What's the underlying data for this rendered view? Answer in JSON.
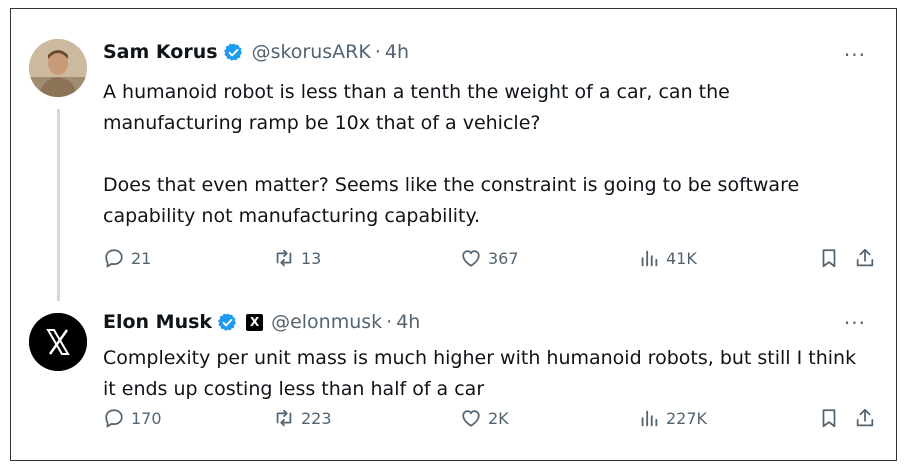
{
  "tweets": [
    {
      "author_name": "Sam Korus",
      "handle": "@skorusARK",
      "separator": "·",
      "time": "4h",
      "more": "···",
      "paragraphs": [
        "A humanoid robot is less than a tenth the weight of a car, can the manufacturing ramp be 10x that of a vehicle?",
        "Does that even matter? Seems like the constraint is going to be software capability not manufacturing capability."
      ],
      "replies": "21",
      "reposts": "13",
      "likes": "367",
      "views": "41K"
    },
    {
      "author_name": "Elon Musk",
      "handle": "@elonmusk",
      "separator": "·",
      "time": "4h",
      "more": "···",
      "affiliate_badge": "X",
      "paragraphs": [
        "Complexity per unit mass is much higher with humanoid robots, but still I think it ends up costing less than half of a car"
      ],
      "replies": "170",
      "reposts": "223",
      "likes": "2K",
      "views": "227K"
    }
  ],
  "colors": {
    "verified": "#1d9bf0",
    "secondary_text": "#536471",
    "thread_line": "#cfd9de"
  },
  "icons": [
    "verified-icon",
    "reply-icon",
    "repost-icon",
    "like-icon",
    "views-icon",
    "bookmark-icon",
    "share-icon",
    "x-logo-icon"
  ]
}
